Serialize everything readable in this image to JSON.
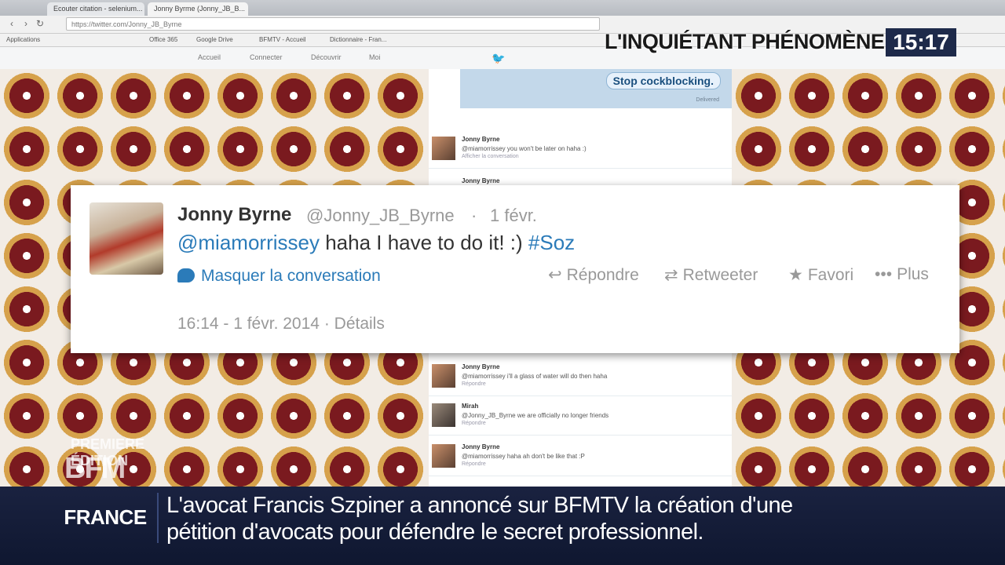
{
  "browser": {
    "tabs": [
      "Ecouter citation - selenium...",
      "Jonny Byrme (Jonny_JB_B..."
    ],
    "url": "https://twitter.com/Jonny_JB_Byrne",
    "bookmarks": [
      "Applications",
      "Office 365",
      "Google Drive",
      "BFMTV - Accueil",
      "Dictionnaire - Fran..."
    ]
  },
  "twitter_nav": {
    "items": [
      "Accueil",
      "Connecter",
      "Découvrir",
      "Moi"
    ]
  },
  "dm": {
    "bubble": "Stop cockblocking.",
    "status": "Delivered"
  },
  "mini_tweets": [
    {
      "name": "Jonny Byrne",
      "text": "@miamorrissey you won't be later on haha :)",
      "meta": "Afficher la conversation"
    },
    {
      "name": "Jonny Byrne",
      "text": "",
      "meta": ""
    },
    {
      "name": "Jonny Byrne",
      "text": "@miamorrissey i'll a glass of water will do then haha",
      "meta": "Répondre"
    },
    {
      "name": "Mirah",
      "text": "@Jonny_JB_Byrne we are officially no longer friends",
      "meta": "Répondre"
    },
    {
      "name": "Jonny Byrne",
      "text": "@miamorrissey haha ah don't be like that :P",
      "meta": "Répondre"
    }
  ],
  "tweet": {
    "name": "Jonny Byrne",
    "handle": "@Jonny_JB_Byrne",
    "dot": "·",
    "date": "1 févr.",
    "mention": "@miamorrissey",
    "body": " haha I have to do it! :) ",
    "hashtag": "#Soz",
    "conversation": "Masquer la conversation",
    "actions": {
      "reply": "Répondre",
      "retweet": "Retweeter",
      "favorite": "Favori",
      "more": "Plus"
    },
    "footer_time": "16:14 - 1 févr. 2014",
    "footer_dot": "·",
    "footer_details": "Détails"
  },
  "tv": {
    "topic": "L'INQUIÉTANT PHÉNOMÈNE",
    "clock": "15:17",
    "watermark_small": "PREMIERE ÉDITION",
    "watermark_big": "BFM",
    "ticker_label": "FRANCE",
    "ticker_line1": "L'avocat Francis Szpiner a annoncé sur BFMTV la création d'une",
    "ticker_line2": "pétition d'avocats pour défendre le secret professionnel."
  },
  "colors": {
    "twitter_blue": "#2b7bb9",
    "ticker_bg": "#1a2240",
    "clock_bg": "#1e2a4a",
    "pattern_red": "#7a1a1f",
    "pattern_gold": "#d6a14b"
  }
}
